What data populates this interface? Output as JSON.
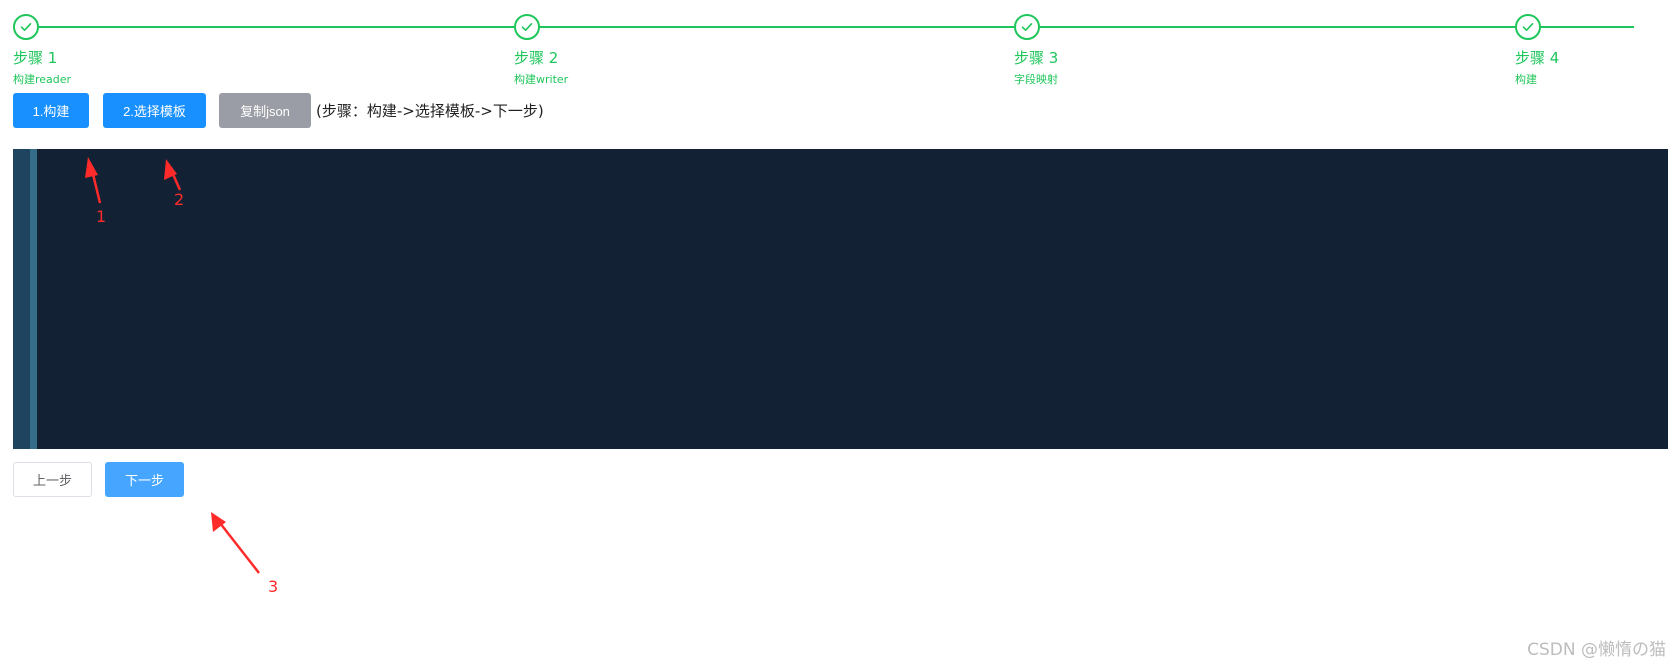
{
  "steps": [
    {
      "title": "步骤 1",
      "desc": "构建reader"
    },
    {
      "title": "步骤 2",
      "desc": "构建writer"
    },
    {
      "title": "步骤 3",
      "desc": "字段映射"
    },
    {
      "title": "步骤 4",
      "desc": "构建"
    }
  ],
  "toolbar": {
    "build_label": "1.构建",
    "select_template_label": "2.选择模板",
    "copy_json_label": "复制json",
    "hint": "(步骤：构建->选择模板->下一步)"
  },
  "nav": {
    "prev_label": "上一步",
    "next_label": "下一步"
  },
  "annotations": {
    "label_1": "1",
    "label_2": "2",
    "label_3": "3"
  },
  "watermark": "CSDN @懒惰の猫",
  "colors": {
    "success": "#1fc65b",
    "primary": "#1890ff",
    "annotation": "#ff2a2a",
    "editor_bg": "#122234"
  },
  "icons": {
    "step_done": "check-icon"
  }
}
